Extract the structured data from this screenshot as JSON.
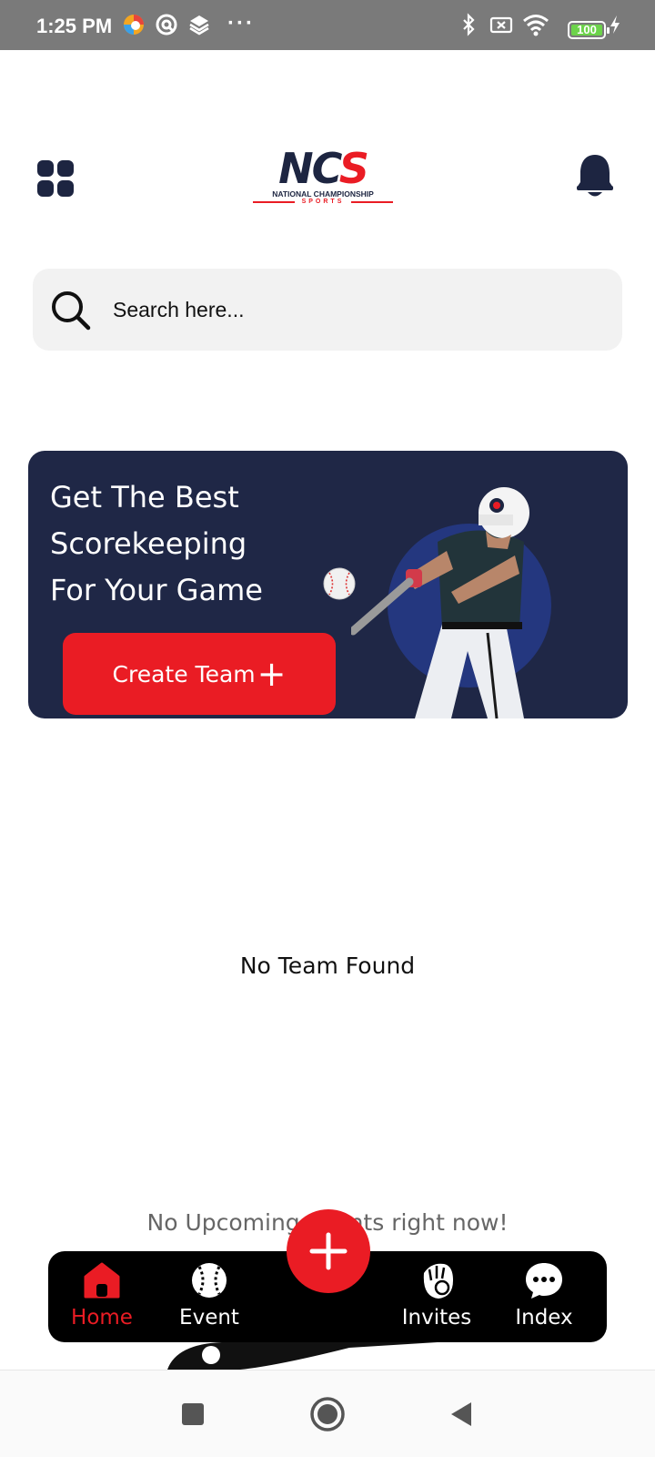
{
  "status_bar": {
    "time": "1:25 PM",
    "icons": [
      "browser-icon",
      "vpn-icon",
      "layers-icon",
      "bluetooth-icon",
      "sim-icon",
      "wifi-icon",
      "battery-icon",
      "charging-icon"
    ],
    "more": "···",
    "battery_level": "100"
  },
  "header": {
    "logo_letters": [
      "NC",
      "S"
    ],
    "logo_subtitle": "NATIONAL CHAMPIONSHIP",
    "logo_subtitle2": "SPORTS"
  },
  "search": {
    "placeholder": "Search here..."
  },
  "banner": {
    "title_lines": [
      "Get The Best",
      "Scorekeeping",
      "For Your Game"
    ],
    "button_label": "Create Team",
    "button_icon": "plus-icon"
  },
  "empty_teams": "No Team Found",
  "empty_events": "No Upcoming Events right now!",
  "bottom_nav": {
    "items": [
      {
        "label": "Home",
        "icon": "home-icon",
        "active": true
      },
      {
        "label": "Event",
        "icon": "baseball-icon",
        "active": false
      },
      {
        "label": "Invites",
        "icon": "glove-icon",
        "active": false
      },
      {
        "label": "Index",
        "icon": "chat-icon",
        "active": false
      }
    ],
    "fab_icon": "plus-icon"
  },
  "colors": {
    "brand_navy": "#1f2746",
    "brand_red": "#ea1c24",
    "status_bar": "#7a7a7a",
    "search_bg": "#f2f2f2"
  }
}
